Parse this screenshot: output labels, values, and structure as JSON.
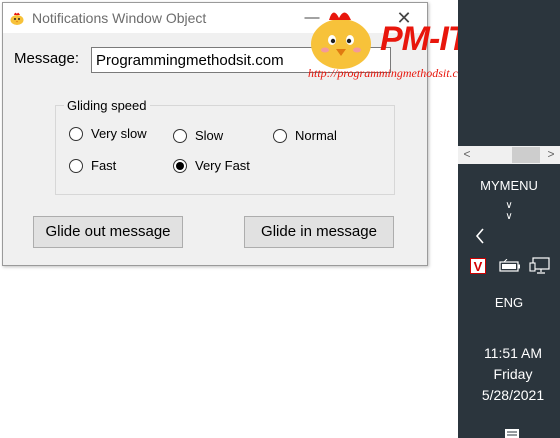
{
  "window": {
    "title": "Notifications Window Object",
    "minimize_glyph": "—",
    "close_glyph": "✕",
    "icon": "chick-app-icon"
  },
  "form": {
    "message_label": "Message:",
    "message_value": "Programmingmethodsit.com",
    "group_label": "Gliding speed",
    "speeds": [
      {
        "label": "Very slow",
        "checked": false
      },
      {
        "label": "Slow",
        "checked": false
      },
      {
        "label": "Normal",
        "checked": false
      },
      {
        "label": "Fast",
        "checked": false
      },
      {
        "label": "Very Fast",
        "checked": true
      }
    ],
    "glide_out_label": "Glide out message",
    "glide_in_label": "Glide in message"
  },
  "watermark": {
    "brand": "PM-IT",
    "url": "http://programmingmethodsit.com",
    "color": "#e8160c"
  },
  "taskbar": {
    "menu_label": "MYMENU",
    "language": "ENG",
    "time": "11:51 AM",
    "day": "Friday",
    "date": "5/28/2021",
    "background": "#2b353d",
    "icons": [
      "chevron-left-icon",
      "app-v-icon",
      "battery-icon",
      "network-icon",
      "notification-icon"
    ]
  },
  "scrollbar": {
    "left_arrow": "<",
    "right_arrow": ">"
  }
}
